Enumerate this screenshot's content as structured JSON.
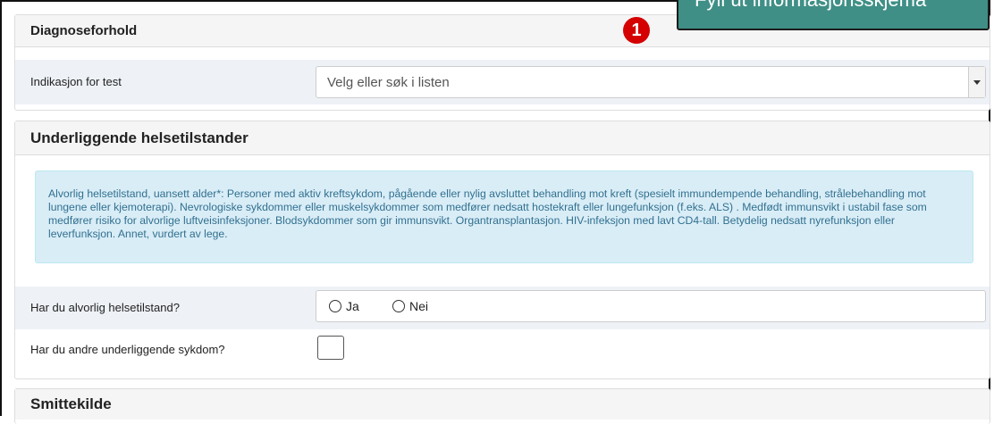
{
  "tooltip": {
    "text": "Fyll ut informasjonsskjema"
  },
  "badge": {
    "number": "1",
    "color": "#d50000"
  },
  "diagnose": {
    "heading": "Diagnoseforhold",
    "indication_label": "Indikasjon for test",
    "select_placeholder": "Velg eller søk i listen"
  },
  "health": {
    "heading": "Underliggende helsetilstander",
    "info_text": "Alvorlig helsetilstand, uansett alder*: Personer med aktiv kreftsykdom, pågående eller nylig avsluttet behandling mot kreft (spesielt immundempende behandling, strålebehandling mot lungene eller kjemoterapi). Nevrologiske sykdommer eller muskelsykdommer som medfører nedsatt hostekraft eller lungefunksjon (f.eks. ALS) . Medfødt immunsvikt i ustabil fase som medfører risiko for alvorlige luftveisinfeksjoner. Blodsykdommer som gir immunsvikt. Organtransplantasjon. HIV-infeksjon med lavt CD4-tall. Betydelig nedsatt nyrefunksjon eller leverfunksjon. Annet, vurdert av lege.",
    "serious_question": "Har du alvorlig helsetilstand?",
    "radio_yes": "Ja",
    "radio_no": "Nei",
    "other_question": "Har du andre underliggende sykdom?"
  },
  "source": {
    "heading": "Smittekilde"
  },
  "colors": {
    "accent": "#3f8f86",
    "info_bg": "#d9edf7",
    "info_text": "#31708f"
  }
}
